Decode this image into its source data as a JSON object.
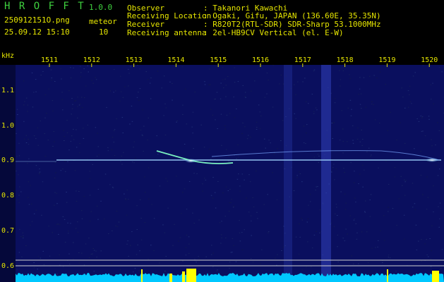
{
  "header": {
    "app_name": "H R O F F T",
    "version": "1.0.0",
    "filename": "250912151O.png",
    "category": "meteor",
    "datetime": "25.09.12 15:10",
    "count": "10",
    "info": [
      {
        "label": "Observer",
        "value": ": Takanori Kawachi"
      },
      {
        "label": "Receiving Location",
        "value": ": Ogaki, Gifu, JAPAN (136.60E, 35.35N)"
      },
      {
        "label": "Receiver",
        "value": ": R820T2(RTL-SDR) SDR-Sharp 53.1000MHz"
      },
      {
        "label": "Receiving antenna",
        "value": ": 2el-HB9CV Vertical (el. E-W)"
      }
    ]
  },
  "axes": {
    "y_unit": "kHz",
    "x_unit": "kHz",
    "x_ticks": [
      "1511",
      "1512",
      "1513",
      "1514",
      "1515",
      "1516",
      "1517",
      "1518",
      "1519",
      "1520"
    ],
    "y_ticks": [
      "1.1",
      "1.0",
      "0.9",
      "0.8",
      "0.7",
      "0.6"
    ]
  },
  "colors": {
    "background": "#000000",
    "spectrogram_bg": "#0a0f5e",
    "header_green": "#3fd13f",
    "label_yellow": "#e6e600",
    "signal": "#a0d8ff",
    "bottom_graph": "#00c8ff"
  }
}
